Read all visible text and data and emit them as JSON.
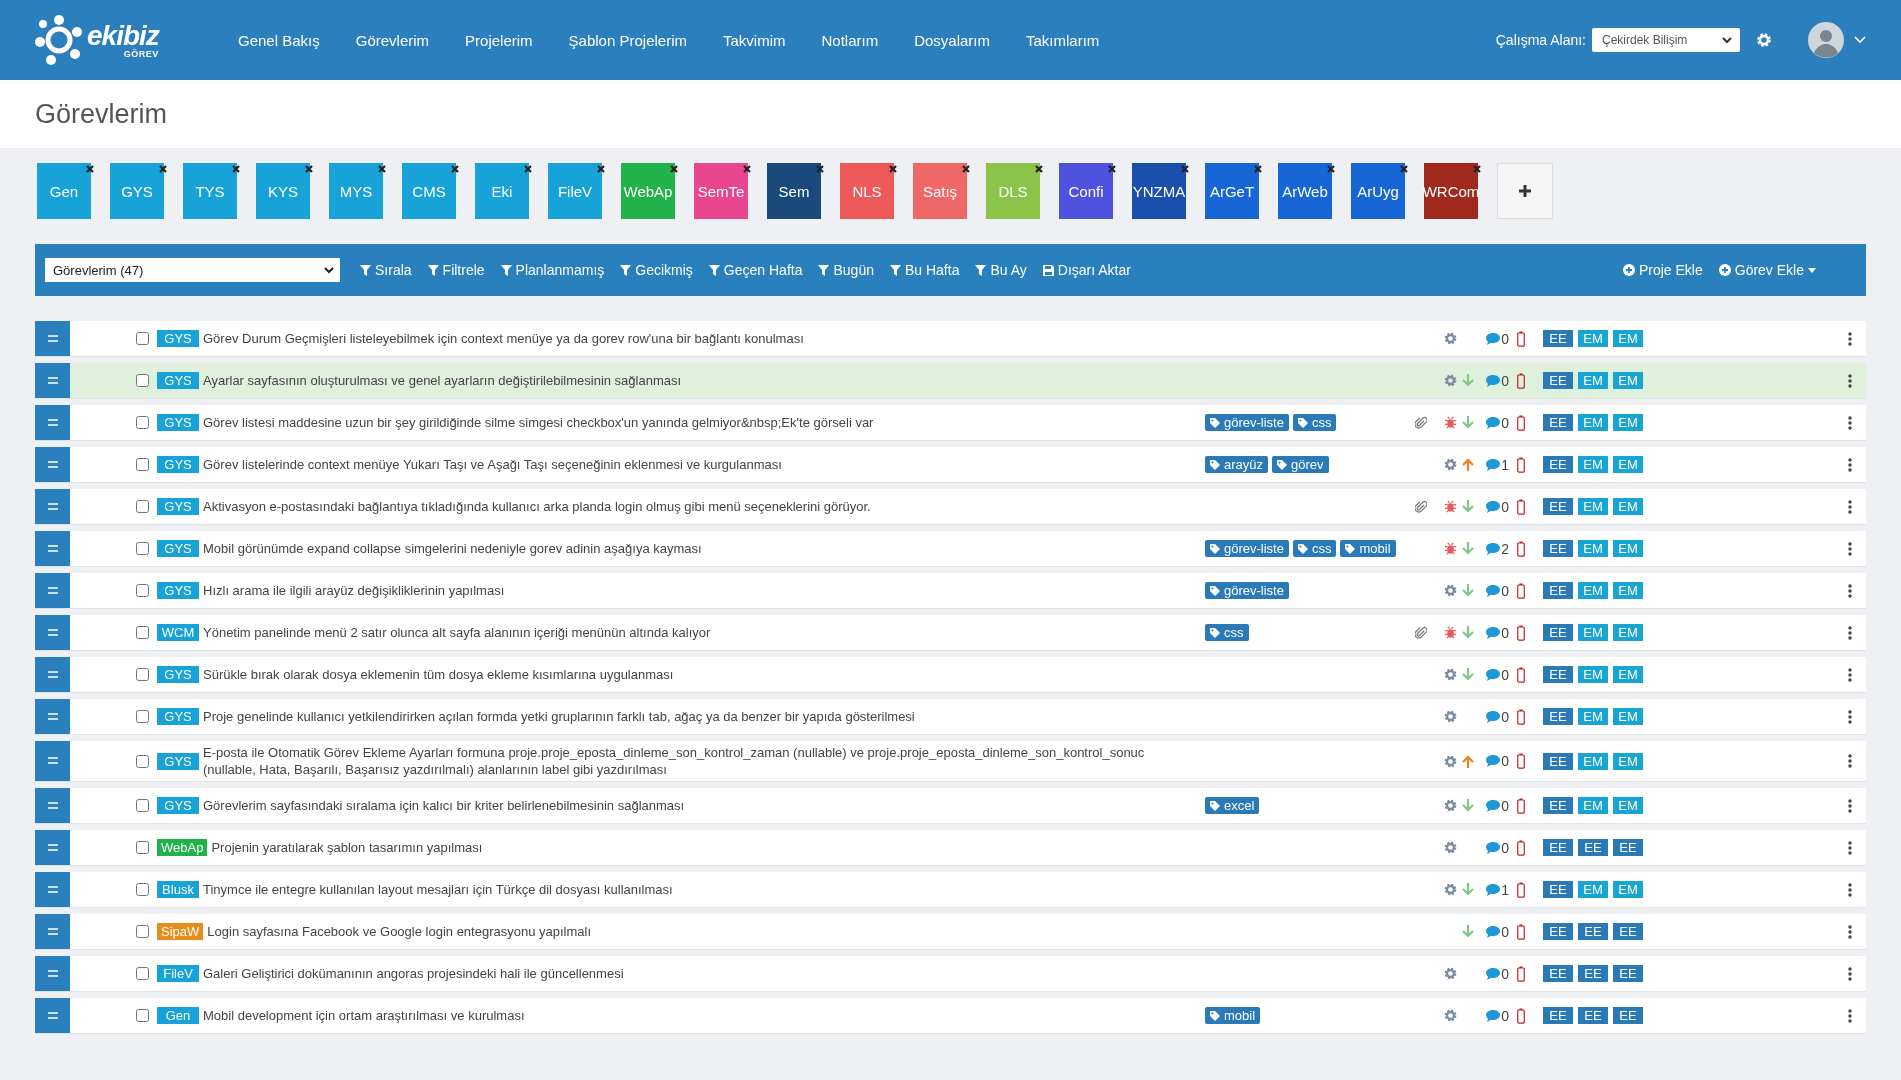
{
  "header": {
    "logo": {
      "name": "ekibiz",
      "subtitle": "GÖREV"
    },
    "nav": [
      "Genel Bakış",
      "Görevlerim",
      "Projelerim",
      "Şablon Projelerim",
      "Takvimim",
      "Notlarım",
      "Dosyalarım",
      "Takımlarım"
    ],
    "workspace_label": "Çalışma Alanı:",
    "workspace_value": "Çekirdek Bilişim"
  },
  "page_title": "Görevlerim",
  "projects": [
    {
      "label": "Gen",
      "color": "#17a2d8"
    },
    {
      "label": "GYS",
      "color": "#17a2d8"
    },
    {
      "label": "TYS",
      "color": "#17a2d8"
    },
    {
      "label": "KYS",
      "color": "#17a2d8"
    },
    {
      "label": "MYS",
      "color": "#17a2d8"
    },
    {
      "label": "CMS",
      "color": "#17a2d8"
    },
    {
      "label": "Eki",
      "color": "#17a2d8"
    },
    {
      "label": "FileV",
      "color": "#17a2d8"
    },
    {
      "label": "WebAp",
      "color": "#22b24c"
    },
    {
      "label": "SemTe",
      "color": "#e8468e"
    },
    {
      "label": "Sem",
      "color": "#1a4a7c"
    },
    {
      "label": "NLS",
      "color": "#ee5a5a"
    },
    {
      "label": "Satış",
      "color": "#ef6868"
    },
    {
      "label": "DLS",
      "color": "#8cc44a"
    },
    {
      "label": "Confi",
      "color": "#4f52df"
    },
    {
      "label": "YNZMA",
      "color": "#1b4fae"
    },
    {
      "label": "ArGeT",
      "color": "#1666d6"
    },
    {
      "label": "ArWeb",
      "color": "#1666d6"
    },
    {
      "label": "ArUyg",
      "color": "#1666d6"
    },
    {
      "label": "WRCom",
      "color": "#a0291e"
    }
  ],
  "toolbar": {
    "list_select": "Görevlerim (47)",
    "filters": [
      {
        "label": "Sırala",
        "kind": "filter"
      },
      {
        "label": "Filtrele",
        "kind": "filter"
      },
      {
        "label": "Planlanmamış",
        "kind": "filter"
      },
      {
        "label": "Gecikmiş",
        "kind": "filter"
      },
      {
        "label": "Geçen Hafta",
        "kind": "filter"
      },
      {
        "label": "Bugün",
        "kind": "filter"
      },
      {
        "label": "Bu Hafta",
        "kind": "filter"
      },
      {
        "label": "Bu Ay",
        "kind": "filter"
      },
      {
        "label": "Dışarı Aktar",
        "kind": "export"
      }
    ],
    "actions": [
      {
        "label": "Proje Ekle",
        "dropdown": false
      },
      {
        "label": "Görev Ekle",
        "dropdown": true
      }
    ]
  },
  "tasks": [
    {
      "kind": "task",
      "project": {
        "label": "GYS",
        "color": "#17a2d8"
      },
      "title": "Görev Durum Geçmişleri listeleyebilmek için context menüye ya da gorev row'una bir bağlantı konulması",
      "attachment": false,
      "comments": "0",
      "checked": false,
      "highlighted": false,
      "assignees": [
        {
          "label": "EE",
          "color": "#2a7ab8"
        },
        {
          "label": "EM",
          "color": "#19a5d3"
        },
        {
          "label": "EM",
          "color": "#19a5d3"
        }
      ]
    },
    {
      "kind": "task",
      "project": {
        "label": "GYS",
        "color": "#17a2d8"
      },
      "title": "Ayarlar sayfasının oluşturulması ve genel ayarların değiştirilebilmesinin sağlanması",
      "attachment": false,
      "priority": {
        "kind": "down"
      },
      "comments": "0",
      "checked": false,
      "highlighted": true,
      "assignees": [
        {
          "label": "EE",
          "color": "#2a7ab8"
        },
        {
          "label": "EM",
          "color": "#19a5d3"
        },
        {
          "label": "EM",
          "color": "#19a5d3"
        }
      ]
    },
    {
      "kind": "bug",
      "project": {
        "label": "GYS",
        "color": "#17a2d8"
      },
      "title": "Görev listesi maddesine uzun bir şey girildiğinde silme simgesi checkbox'un yanında gelmiyor&nbsp;Ek'te görseli var",
      "tags": [
        "görev-liste",
        "css"
      ],
      "attachment": true,
      "priority": {
        "kind": "down"
      },
      "comments": "0",
      "checked": false,
      "highlighted": false,
      "assignees": [
        {
          "label": "EE",
          "color": "#2a7ab8"
        },
        {
          "label": "EM",
          "color": "#19a5d3"
        },
        {
          "label": "EM",
          "color": "#19a5d3"
        }
      ]
    },
    {
      "kind": "task",
      "project": {
        "label": "GYS",
        "color": "#17a2d8"
      },
      "title": "Görev listelerinde context menüye Yukarı Taşı ve Aşağı Taşı seçeneğinin eklenmesi ve kurgulanması",
      "tags": [
        "arayüz",
        "görev"
      ],
      "attachment": false,
      "priority": {
        "kind": "up"
      },
      "comments": "1",
      "checked": false,
      "highlighted": false,
      "assignees": [
        {
          "label": "EE",
          "color": "#2a7ab8"
        },
        {
          "label": "EM",
          "color": "#19a5d3"
        },
        {
          "label": "EM",
          "color": "#19a5d3"
        }
      ]
    },
    {
      "kind": "bug",
      "project": {
        "label": "GYS",
        "color": "#17a2d8"
      },
      "title": "Aktivasyon e-postasındaki bağlantıya tıkladığında kullanıcı arka planda login olmuş gibi menü seçeneklerini görüyor.",
      "attachment": true,
      "priority": {
        "kind": "down"
      },
      "comments": "0",
      "checked": false,
      "highlighted": false,
      "assignees": [
        {
          "label": "EE",
          "color": "#2a7ab8"
        },
        {
          "label": "EM",
          "color": "#19a5d3"
        },
        {
          "label": "EM",
          "color": "#19a5d3"
        }
      ]
    },
    {
      "kind": "bug",
      "project": {
        "label": "GYS",
        "color": "#17a2d8"
      },
      "title": "Mobil görünümde expand collapse simgelerini nedeniyle gorev adinin aşağıya kayması",
      "tags": [
        "görev-liste",
        "css",
        "mobil"
      ],
      "attachment": false,
      "priority": {
        "kind": "down"
      },
      "comments": "2",
      "checked": false,
      "highlighted": false,
      "assignees": [
        {
          "label": "EE",
          "color": "#2a7ab8"
        },
        {
          "label": "EM",
          "color": "#19a5d3"
        },
        {
          "label": "EM",
          "color": "#19a5d3"
        }
      ]
    },
    {
      "kind": "task",
      "project": {
        "label": "GYS",
        "color": "#17a2d8"
      },
      "title": "Hızlı arama ile ilgili arayüz değişikliklerinin yapılması",
      "tags": [
        "görev-liste"
      ],
      "attachment": false,
      "priority": {
        "kind": "down"
      },
      "comments": "0",
      "checked": false,
      "highlighted": false,
      "assignees": [
        {
          "label": "EE",
          "color": "#2a7ab8"
        },
        {
          "label": "EM",
          "color": "#19a5d3"
        },
        {
          "label": "EM",
          "color": "#19a5d3"
        }
      ]
    },
    {
      "kind": "bug",
      "project": {
        "label": "WCM",
        "color": "#17a2d8"
      },
      "title": "Yönetim panelinde menü 2 satır olunca alt sayfa alanının içeriği menünün altında kalıyor",
      "tags": [
        "css"
      ],
      "attachment": true,
      "priority": {
        "kind": "down"
      },
      "comments": "0",
      "checked": false,
      "highlighted": false,
      "assignees": [
        {
          "label": "EE",
          "color": "#2a7ab8"
        },
        {
          "label": "EM",
          "color": "#19a5d3"
        },
        {
          "label": "EM",
          "color": "#19a5d3"
        }
      ]
    },
    {
      "kind": "task",
      "project": {
        "label": "GYS",
        "color": "#17a2d8"
      },
      "title": "Sürükle bırak olarak dosya eklemenin tüm dosya ekleme kısımlarına uygulanması",
      "attachment": false,
      "priority": {
        "kind": "down"
      },
      "comments": "0",
      "checked": false,
      "highlighted": false,
      "assignees": [
        {
          "label": "EE",
          "color": "#2a7ab8"
        },
        {
          "label": "EM",
          "color": "#19a5d3"
        },
        {
          "label": "EM",
          "color": "#19a5d3"
        }
      ]
    },
    {
      "kind": "task",
      "project": {
        "label": "GYS",
        "color": "#17a2d8"
      },
      "title": "Proje genelinde kullanıcı yetkilendirirken açılan formda yetki gruplarının farklı tab, ağaç ya da benzer bir yapıda gösterilmesi",
      "attachment": false,
      "comments": "0",
      "checked": false,
      "highlighted": false,
      "assignees": [
        {
          "label": "EE",
          "color": "#2a7ab8"
        },
        {
          "label": "EM",
          "color": "#19a5d3"
        },
        {
          "label": "EM",
          "color": "#19a5d3"
        }
      ]
    },
    {
      "kind": "task",
      "project": {
        "label": "GYS",
        "color": "#17a2d8"
      },
      "title": "E-posta ile Otomatik Görev Ekleme Ayarları formuna proje.proje_eposta_dinleme_son_kontrol_zaman (nullable) ve proje.proje_eposta_dinleme_son_kontrol_sonuc (nullable, Hata, Başarılı, Başarısız yazdırılmalı) alanlarının label gibi yazdırılması",
      "attachment": false,
      "priority": {
        "kind": "up"
      },
      "comments": "0",
      "checked": false,
      "highlighted": false,
      "assignees": [
        {
          "label": "EE",
          "color": "#2a7ab8"
        },
        {
          "label": "EM",
          "color": "#19a5d3"
        },
        {
          "label": "EM",
          "color": "#19a5d3"
        }
      ]
    },
    {
      "kind": "task",
      "project": {
        "label": "GYS",
        "color": "#17a2d8"
      },
      "title": "Görevlerim sayfasındaki sıralama için kalıcı bir kriter belirlenebilmesinin sağlanması",
      "tags": [
        "excel"
      ],
      "attachment": false,
      "priority": {
        "kind": "down"
      },
      "comments": "0",
      "checked": false,
      "highlighted": false,
      "assignees": [
        {
          "label": "EE",
          "color": "#2a7ab8"
        },
        {
          "label": "EM",
          "color": "#19a5d3"
        },
        {
          "label": "EM",
          "color": "#19a5d3"
        }
      ]
    },
    {
      "kind": "task",
      "project": {
        "label": "WebAp",
        "color": "#22b24c"
      },
      "title": "Projenin yaratılarak şablon tasarımın yapılması",
      "attachment": false,
      "comments": "0",
      "checked": false,
      "highlighted": false,
      "assignees": [
        {
          "label": "EE",
          "color": "#2a7ab8"
        },
        {
          "label": "EE",
          "color": "#2a7ab8"
        },
        {
          "label": "EE",
          "color": "#2a7ab8"
        }
      ]
    },
    {
      "kind": "task",
      "project": {
        "label": "Blusk",
        "color": "#17a2d8"
      },
      "title": "Tinymce ile entegre kullanılan layout mesajları için Türkçe dil dosyası kullanılması",
      "attachment": false,
      "priority": {
        "kind": "down"
      },
      "comments": "1",
      "checked": false,
      "highlighted": false,
      "assignees": [
        {
          "label": "EE",
          "color": "#2a7ab8"
        },
        {
          "label": "EM",
          "color": "#19a5d3"
        },
        {
          "label": "EM",
          "color": "#19a5d3"
        }
      ]
    },
    {
      "kind": "plain",
      "project": {
        "label": "SipaW",
        "color": "#e88d1c"
      },
      "title": "Login sayfasına Facebook ve Google login entegrasyonu yapılmalı",
      "attachment": false,
      "priority": {
        "kind": "down"
      },
      "comments": "0",
      "checked": false,
      "highlighted": false,
      "assignees": [
        {
          "label": "EE",
          "color": "#2a7ab8"
        },
        {
          "label": "EE",
          "color": "#2a7ab8"
        },
        {
          "label": "EE",
          "color": "#2a7ab8"
        }
      ]
    },
    {
      "kind": "task",
      "project": {
        "label": "FileV",
        "color": "#17a2d8"
      },
      "title": "Galeri Geliştirici dokümanının angoras projesindeki hali ile güncellenmesi",
      "attachment": false,
      "comments": "0",
      "checked": false,
      "highlighted": false,
      "assignees": [
        {
          "label": "EE",
          "color": "#2a7ab8"
        },
        {
          "label": "EE",
          "color": "#2a7ab8"
        },
        {
          "label": "EE",
          "color": "#2a7ab8"
        }
      ]
    },
    {
      "kind": "task",
      "project": {
        "label": "Gen",
        "color": "#17a2d8"
      },
      "title": "Mobil development için ortam araştırılması ve kurulması",
      "tags": [
        "mobil"
      ],
      "attachment": false,
      "comments": "0",
      "checked": false,
      "highlighted": false,
      "assignees": [
        {
          "label": "EE",
          "color": "#2a7ab8"
        },
        {
          "label": "EE",
          "color": "#2a7ab8"
        },
        {
          "label": "EE",
          "color": "#2a7ab8"
        }
      ]
    }
  ]
}
